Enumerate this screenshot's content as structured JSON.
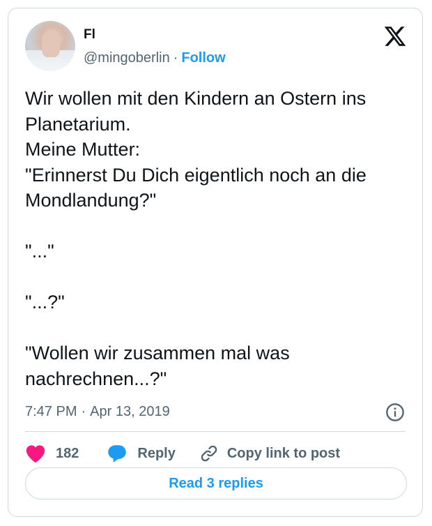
{
  "author": {
    "name": "Fl",
    "handle": "@mingoberlin",
    "separator": "·",
    "follow_label": "Follow"
  },
  "tweet": {
    "text": "Wir wollen mit den Kindern an Ostern ins Planetarium.\nMeine Mutter:\n\"Erinnerst Du Dich eigentlich noch an die Mondlandung?\"\n\n\"...\"\n\n\"...?\"\n\n\"Wollen wir zusammen mal was nachrechnen...?\"",
    "time": "7:47 PM",
    "separator": "·",
    "date": "Apr 13, 2019"
  },
  "actions": {
    "like_count": "182",
    "reply_label": "Reply",
    "copy_link_label": "Copy link to post"
  },
  "read_replies_label": "Read 3 replies",
  "icons": {
    "logo": "x-logo-icon",
    "info": "info-icon",
    "like": "heart-icon",
    "reply": "speech-bubble-icon",
    "copy": "link-icon"
  },
  "colors": {
    "accent": "#1d9bf0",
    "like": "#f91880",
    "text": "#0f1419",
    "secondary": "#536471",
    "border": "#cfd9de"
  }
}
